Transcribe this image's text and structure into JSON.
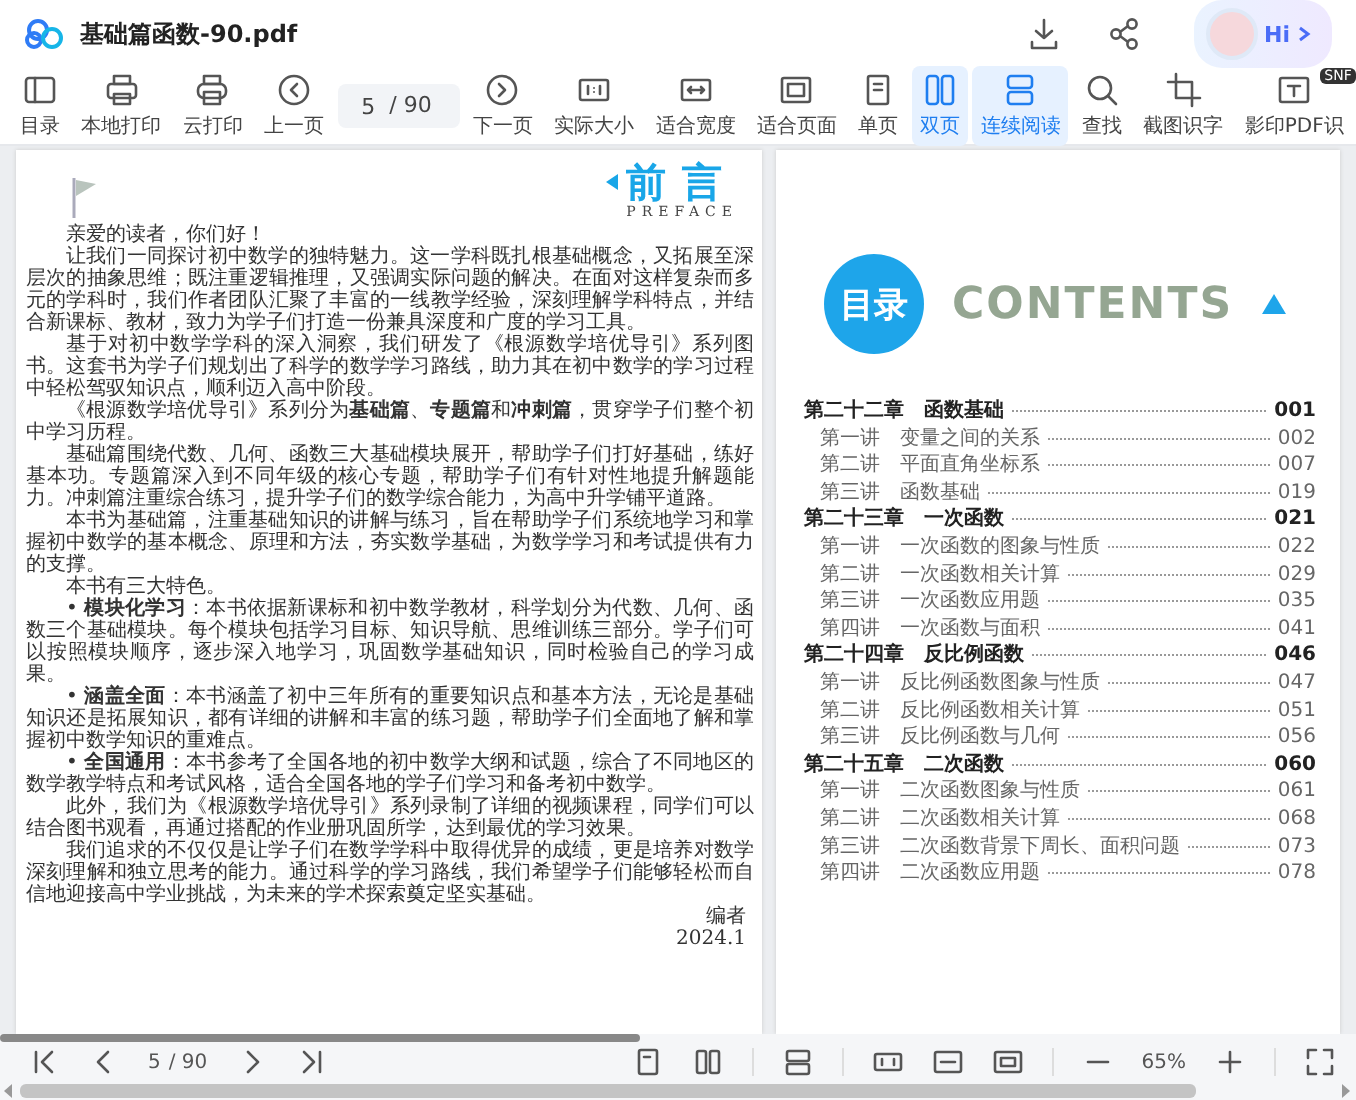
{
  "window": {
    "title": "基础篇函数-90.pdf",
    "greeting_button": "Hi"
  },
  "toolbar": {
    "items": [
      {
        "kind": "button",
        "label": "目录",
        "selected": false
      },
      {
        "kind": "button",
        "label": "本地打印",
        "selected": false
      },
      {
        "kind": "button",
        "label": "云打印",
        "selected": false
      },
      {
        "kind": "button",
        "label": "上一页",
        "selected": false
      },
      {
        "kind": "page",
        "value": "5",
        "total": "/ 90"
      },
      {
        "kind": "button",
        "label": "下一页",
        "selected": false
      },
      {
        "kind": "button",
        "label": "实际大小",
        "selected": false
      },
      {
        "kind": "button",
        "label": "适合宽度",
        "selected": false
      },
      {
        "kind": "button",
        "label": "适合页面",
        "selected": false
      },
      {
        "kind": "button",
        "label": "单页",
        "selected": false
      },
      {
        "kind": "button",
        "label": "双页",
        "selected": true
      },
      {
        "kind": "button",
        "label": "连续阅读",
        "selected": true
      },
      {
        "kind": "button",
        "label": "查找",
        "selected": false
      },
      {
        "kind": "button",
        "label": "截图识字",
        "selected": false
      },
      {
        "kind": "button",
        "label": "影印PDF识",
        "selected": false,
        "badge": "SNF"
      }
    ]
  },
  "preface": {
    "title": "前言",
    "subtitle": "PREFACE",
    "greeting": "亲爱的读者，你们好！",
    "paragraphs": [
      "让我们一同探讨初中数学的独特魅力。这一学科既扎根基础概念，又拓展至深层次的抽象思维；既注重逻辑推理，又强调实际问题的解决。在面对这样复杂而多元的学科时，我们作者团队汇聚了丰富的一线教学经验，深刻理解学科特点，并结合新课标、教材，致力为学子们打造一份兼具深度和广度的学习工具。",
      "基于对初中数学学科的深入洞察，我们研发了《根源数学培优导引》系列图书。这套书为学子们规划出了科学的数学学习路线，助力其在初中数学的学习过程中轻松驾驭知识点，顺利迈入高中阶段。",
      "《根源数学培优导引》系列分为**基础篇**、**专题篇**和**冲刺篇**，贯穿学子们整个初中学习历程。",
      "基础篇围绕代数、几何、函数三大基础模块展开，帮助学子们打好基础，练好基本功。专题篇深入到不同年级的核心专题，帮助学子们有针对性地提升解题能力。冲刺篇注重综合练习，提升学子们的数学综合能力，为高中升学铺平道路。",
      "本书为基础篇，注重基础知识的讲解与练习，旨在帮助学子们系统地学习和掌握初中数学的基本概念、原理和方法，夯实数学基础，为数学学习和考试提供有力的支撑。",
      "本书有三大特色。",
      "• **模块化学习**：本书依据新课标和初中数学教材，科学划分为代数、几何、函数三个基础模块。每个模块包括学习目标、知识导航、思维训练三部分。学子们可以按照模块顺序，逐步深入地学习，巩固数学基础知识，同时检验自己的学习成果。",
      "• **涵盖全面**：本书涵盖了初中三年所有的重要知识点和基本方法，无论是基础知识还是拓展知识，都有详细的讲解和丰富的练习题，帮助学子们全面地了解和掌握初中数学知识的重难点。",
      "• **全国通用**：本书参考了全国各地的初中数学大纲和试题，综合了不同地区的数学教学特点和考试风格，适合全国各地的学子们学习和备考初中数学。",
      "此外，我们为《根源数学培优导引》系列录制了详细的视频课程，同学们可以结合图书观看，再通过搭配的作业册巩固所学，达到最优的学习效果。",
      "我们追求的不仅仅是让学子们在数学学科中取得优异的成绩，更是培养对数学深刻理解和独立思考的能力。通过科学的学习路线，我们希望学子们能够轻松而自信地迎接高中学业挑战，为未来的学术探索奠定坚实基础。"
    ],
    "signature": "编者",
    "date": "2024.1"
  },
  "contents": {
    "title": "目录",
    "subtitle": "CONTENTS",
    "entries": [
      {
        "kind": "chapter",
        "number": "第二十二章",
        "title": "函数基础",
        "page": "001"
      },
      {
        "kind": "lesson",
        "number": "第一讲",
        "title": "变量之间的关系",
        "page": "002"
      },
      {
        "kind": "lesson",
        "number": "第二讲",
        "title": "平面直角坐标系",
        "page": "007"
      },
      {
        "kind": "lesson",
        "number": "第三讲",
        "title": "函数基础",
        "page": "019"
      },
      {
        "kind": "chapter",
        "number": "第二十三章",
        "title": "一次函数",
        "page": "021"
      },
      {
        "kind": "lesson",
        "number": "第一讲",
        "title": "一次函数的图象与性质",
        "page": "022"
      },
      {
        "kind": "lesson",
        "number": "第二讲",
        "title": "一次函数相关计算",
        "page": "029"
      },
      {
        "kind": "lesson",
        "number": "第三讲",
        "title": "一次函数应用题",
        "page": "035"
      },
      {
        "kind": "lesson",
        "number": "第四讲",
        "title": "一次函数与面积",
        "page": "041"
      },
      {
        "kind": "chapter",
        "number": "第二十四章",
        "title": "反比例函数",
        "page": "046"
      },
      {
        "kind": "lesson",
        "number": "第一讲",
        "title": "反比例函数图象与性质",
        "page": "047"
      },
      {
        "kind": "lesson",
        "number": "第二讲",
        "title": "反比例函数相关计算",
        "page": "051"
      },
      {
        "kind": "lesson",
        "number": "第三讲",
        "title": "反比例函数与几何",
        "page": "056"
      },
      {
        "kind": "chapter",
        "number": "第二十五章",
        "title": "二次函数",
        "page": "060"
      },
      {
        "kind": "lesson",
        "number": "第一讲",
        "title": "二次函数图象与性质",
        "page": "061"
      },
      {
        "kind": "lesson",
        "number": "第二讲",
        "title": "二次函数相关计算",
        "page": "068"
      },
      {
        "kind": "lesson",
        "number": "第三讲",
        "title": "二次函数背景下周长、面积问题",
        "page": "073"
      },
      {
        "kind": "lesson",
        "number": "第四讲",
        "title": "二次函数应用题",
        "page": "078"
      }
    ]
  },
  "status_bar": {
    "page": "5",
    "total": "/ 90",
    "zoom": "65%"
  }
}
